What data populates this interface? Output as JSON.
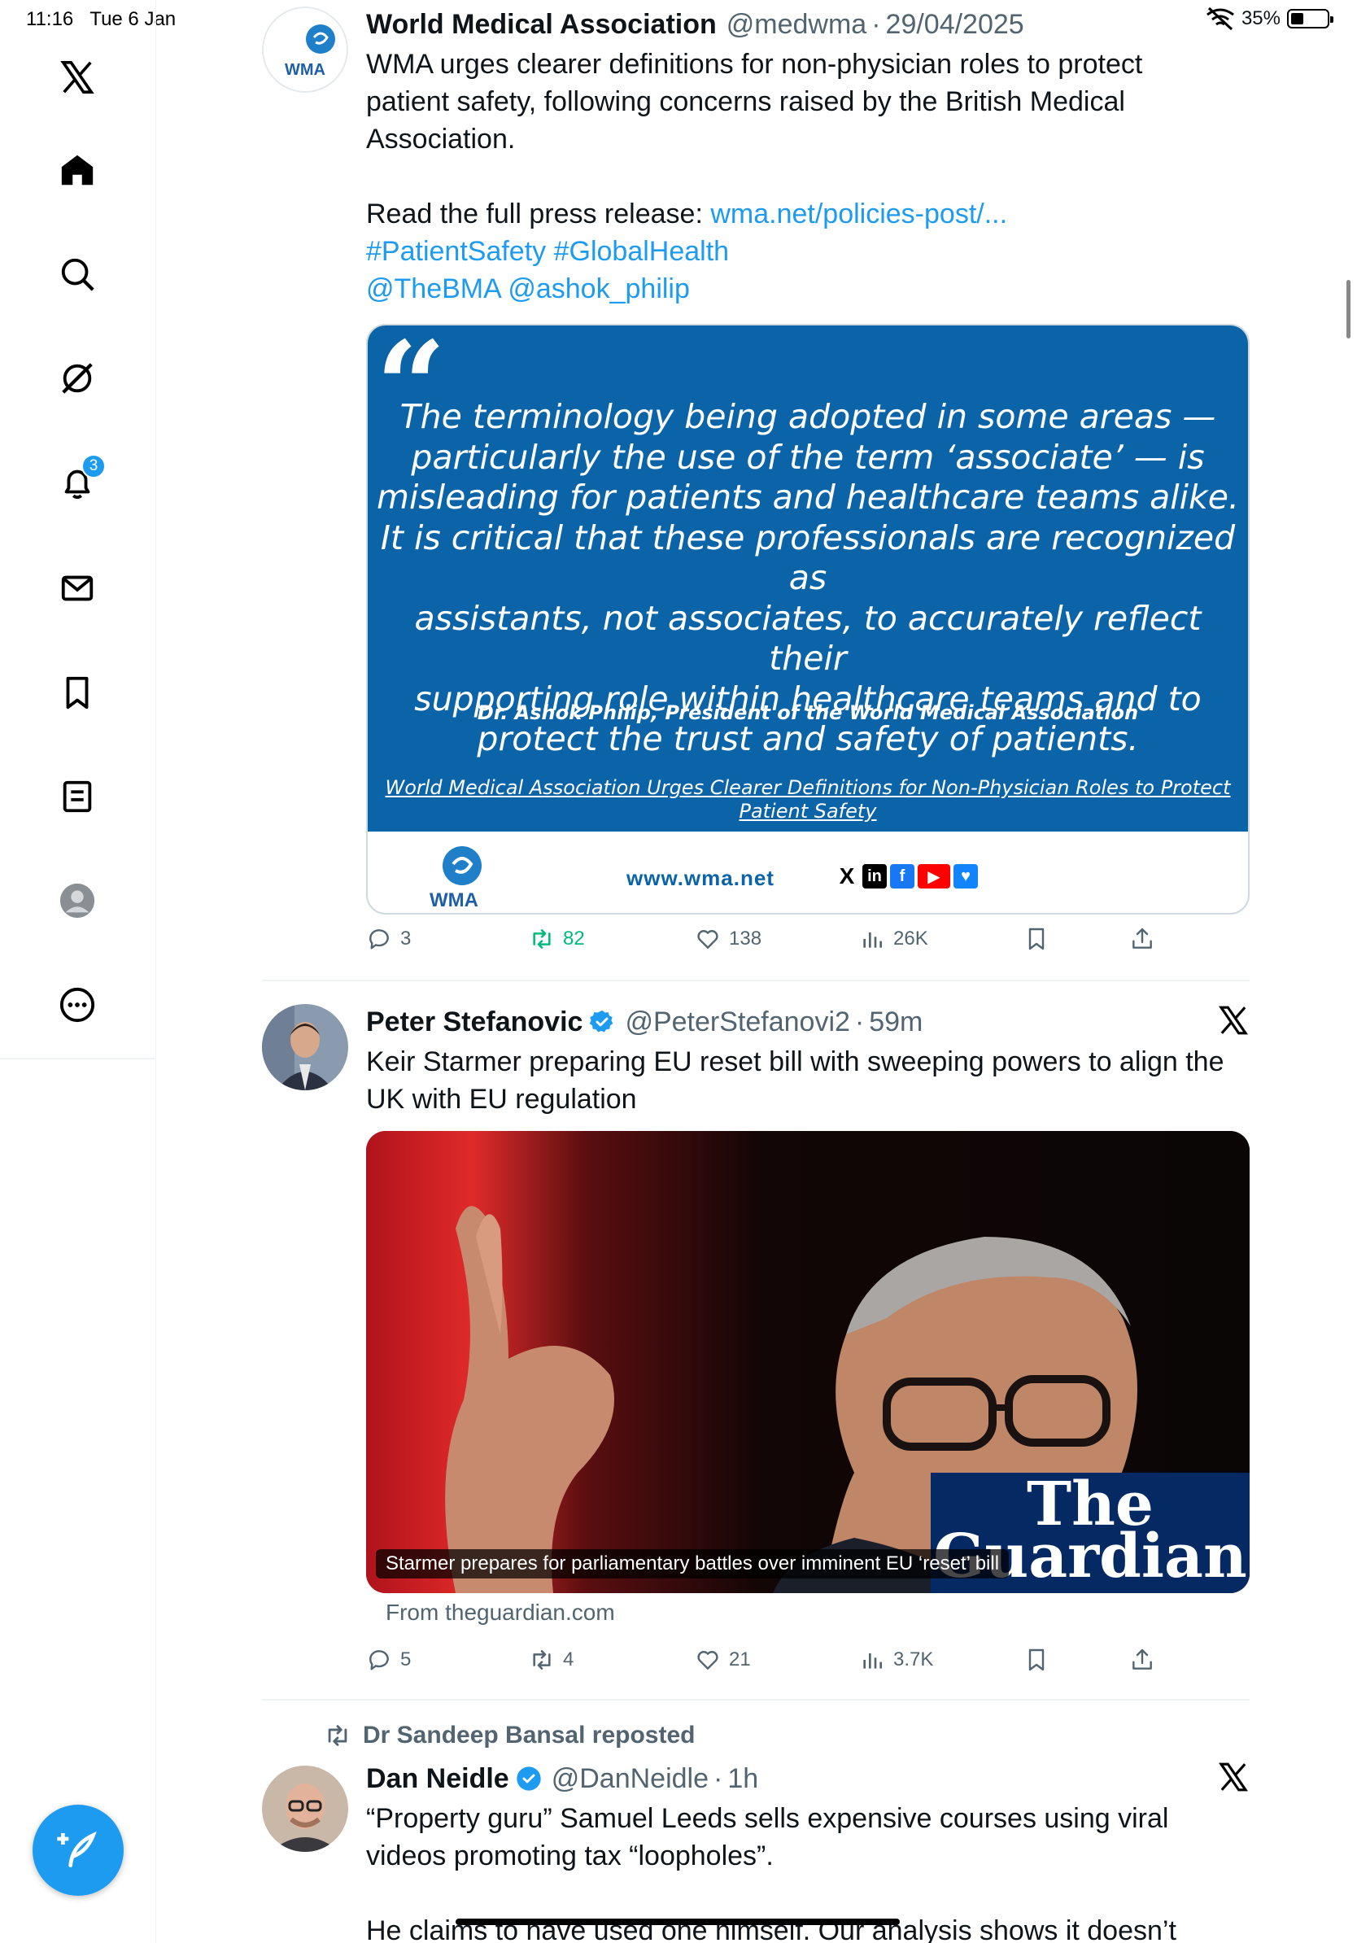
{
  "status_bar": {
    "time": "11:16",
    "date": "Tue 6 Jan",
    "battery": "35%",
    "battery_level": 0.35
  },
  "sidebar": {
    "items": [
      {
        "icon": "x-logo-icon"
      },
      {
        "icon": "home-icon"
      },
      {
        "icon": "search-icon"
      },
      {
        "icon": "grok-icon"
      },
      {
        "icon": "notifications-icon",
        "badge": "3"
      },
      {
        "icon": "messages-icon"
      },
      {
        "icon": "bookmarks-icon"
      },
      {
        "icon": "lists-icon"
      },
      {
        "icon": "profile-icon"
      },
      {
        "icon": "more-icon"
      }
    ],
    "compose_icon": "compose-icon"
  },
  "tweets": [
    {
      "name": "World Medical Association",
      "handle": "@medwma",
      "time": "29/04/2025",
      "avatar_text": "WMA",
      "text_lines": [
        "WMA urges clearer definitions for non-physician roles to protect",
        "patient safety, following concerns raised by the British Medical",
        "Association."
      ],
      "press_prefix": "Read the full press release: ",
      "press_link": "wma.net/policies-post/...",
      "hashtags": "#PatientSafety  #GlobalHealth",
      "mentions": "@TheBMA  @ashok_philip",
      "image": {
        "quote_lines": [
          "The terminology being adopted in some areas —",
          "particularly the use of the term ‘associate’ — is",
          "misleading for patients and healthcare teams alike.",
          "It is critical that these professionals are recognized as",
          "assistants, not associates, to accurately reflect their",
          "supporting role within healthcare teams and to",
          "protect the trust and safety of patients."
        ],
        "author": "Dr. Ashok Philip, President of the World Medical Association",
        "link_lines": [
          "World Medical Association Urges Clearer Definitions for Non-Physician Roles to Protect",
          "Patient Safety"
        ],
        "footer_logo_text": "WMA",
        "footer_site": "www.wma.net",
        "socials": [
          "X",
          "in",
          "f",
          "▶",
          "♥"
        ]
      },
      "stats": {
        "replies": "3",
        "reposts": "82",
        "likes": "138",
        "views": "26K"
      }
    },
    {
      "name": "Peter Stefanovic",
      "handle": "@PeterStefanovi2",
      "time": "59m",
      "text_lines": [
        "Keir Starmer preparing EU reset bill with sweeping powers to align the",
        "UK with EU regulation"
      ],
      "card": {
        "caption": "Starmer prepares for parliamentary battles over imminent EU ‘reset’ bill",
        "logo_line1": "The",
        "logo_line2": "Guardian",
        "from": "From theguardian.com"
      },
      "stats": {
        "replies": "5",
        "reposts": "4",
        "likes": "21",
        "views": "3.7K"
      }
    },
    {
      "reposted_by": "Dr Sandeep Bansal reposted",
      "name": "Dan Neidle",
      "handle": "@DanNeidle",
      "time": "1h",
      "text_lines": [
        "“Property guru” Samuel Leeds sells expensive courses using viral",
        "videos promoting tax “loopholes”."
      ],
      "text_cut": "He claims to have used one himself. Our analysis shows it doesn’t work."
    }
  ],
  "colors": {
    "accent": "#1d9bf0",
    "repost_active": "#00ba7c",
    "wma_blue": "#0b63a8",
    "guardian_navy": "#052962",
    "muted": "#536471"
  }
}
